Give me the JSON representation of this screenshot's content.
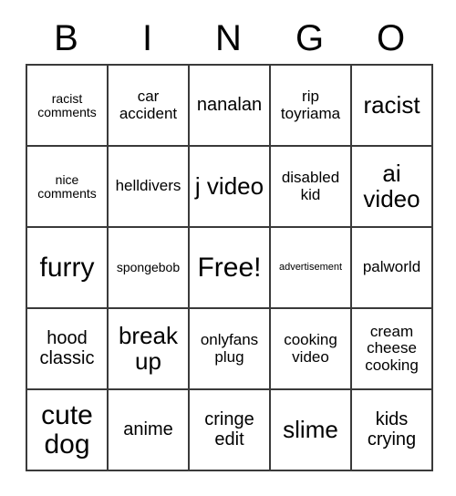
{
  "header": {
    "letters": [
      "B",
      "I",
      "N",
      "G",
      "O"
    ]
  },
  "grid": {
    "rows": 5,
    "columns": 5,
    "border_color": "#3a3a3a",
    "background_color": "#ffffff",
    "text_color": "#000000",
    "cells": [
      [
        {
          "text": "racist comments",
          "size": "fs-s"
        },
        {
          "text": "car accident",
          "size": "fs-m"
        },
        {
          "text": "nanalan",
          "size": "fs-l"
        },
        {
          "text": "rip toyriama",
          "size": "fs-m"
        },
        {
          "text": "racist",
          "size": "fs-xl"
        }
      ],
      [
        {
          "text": "nice comments",
          "size": "fs-s"
        },
        {
          "text": "helldivers",
          "size": "fs-m"
        },
        {
          "text": "j video",
          "size": "fs-xl"
        },
        {
          "text": "disabled kid",
          "size": "fs-m"
        },
        {
          "text": "ai video",
          "size": "fs-xl"
        }
      ],
      [
        {
          "text": "furry",
          "size": "fs-xxl"
        },
        {
          "text": "spongebob",
          "size": "fs-s"
        },
        {
          "text": "Free!",
          "size": "fs-xxl"
        },
        {
          "text": "advertisement",
          "size": "fs-xs"
        },
        {
          "text": "palworld",
          "size": "fs-m"
        }
      ],
      [
        {
          "text": "hood classic",
          "size": "fs-l"
        },
        {
          "text": "break up",
          "size": "fs-xl"
        },
        {
          "text": "onlyfans plug",
          "size": "fs-m"
        },
        {
          "text": "cooking video",
          "size": "fs-m"
        },
        {
          "text": "cream cheese cooking",
          "size": "fs-m"
        }
      ],
      [
        {
          "text": "cute dog",
          "size": "fs-xxl"
        },
        {
          "text": "anime",
          "size": "fs-l"
        },
        {
          "text": "cringe edit",
          "size": "fs-l"
        },
        {
          "text": "slime",
          "size": "fs-xl"
        },
        {
          "text": "kids crying",
          "size": "fs-l"
        }
      ]
    ]
  }
}
